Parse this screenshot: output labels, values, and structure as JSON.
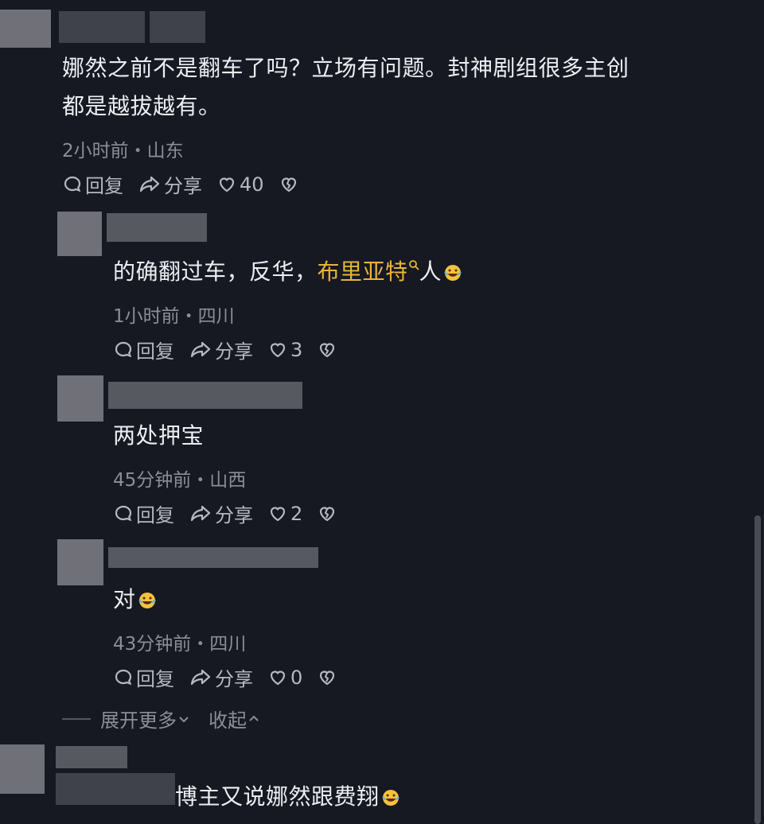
{
  "comments": [
    {
      "text_line1": "娜然之前不是翻车了吗？立场有问题。封神剧组很多主创",
      "text_line2": "都是越拔越有。",
      "meta": "2小时前・山东",
      "reply_label": "回复",
      "share_label": "分享",
      "likes": "40"
    }
  ],
  "replies": [
    {
      "text_before": "的确翻过车，反华，",
      "highlight": "布里亚特",
      "text_after": "人",
      "meta": "1小时前・四川",
      "reply_label": "回复",
      "share_label": "分享",
      "likes": "3"
    },
    {
      "text": "两处押宝",
      "meta": "45分钟前・山西",
      "reply_label": "回复",
      "share_label": "分享",
      "likes": "2"
    },
    {
      "text": "对",
      "meta": "43分钟前・四川",
      "reply_label": "回复",
      "share_label": "分享",
      "likes": "0"
    }
  ],
  "expand": {
    "more_label": "展开更多",
    "collapse_label": "收起"
  },
  "next_comment": {
    "text": "博主又说娜然跟费翔"
  },
  "colors": {
    "background": "#161822",
    "highlight": "#e7b43b",
    "meta": "#8c8e97"
  },
  "icons": [
    "comment-icon",
    "share-icon",
    "heart-icon",
    "dislike-icon",
    "search-icon",
    "laugh-cry-emoji",
    "chevron-down-icon",
    "chevron-up-icon"
  ]
}
